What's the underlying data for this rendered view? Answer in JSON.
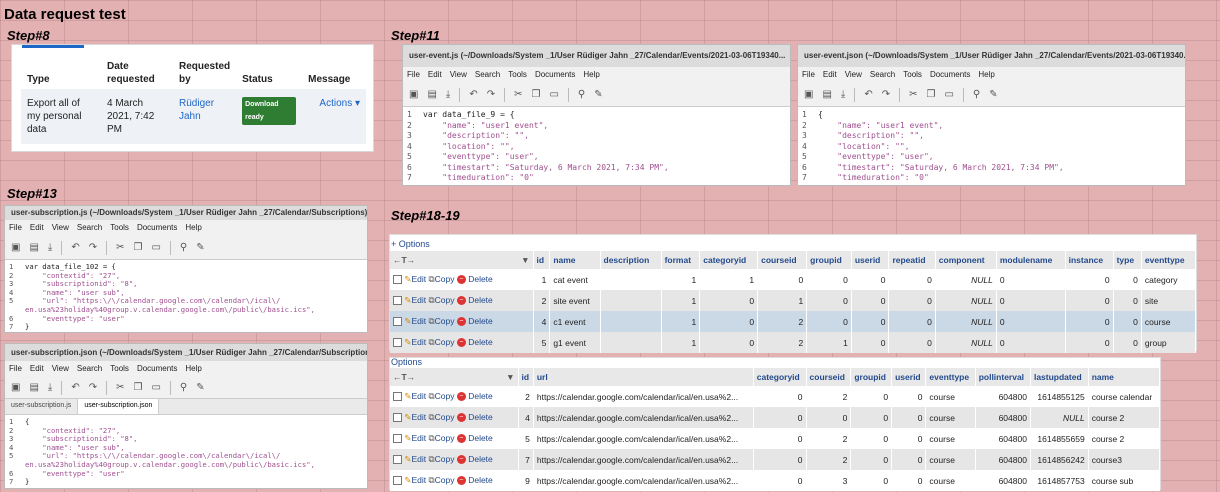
{
  "page_title": "Data request test",
  "steps": {
    "s8": "Step#8",
    "s11": "Step#11",
    "s13": "Step#13",
    "s18": "Step#18-19"
  },
  "request": {
    "headers": [
      "Type",
      "Date requested",
      "Requested by",
      "Status",
      "Message"
    ],
    "row": {
      "type": "Export all of my personal data",
      "date": "4 March 2021, 7:42 PM",
      "by": "Rüdiger Jahn",
      "status": "Download ready",
      "action": "Actions ▾"
    }
  },
  "editor_menu": [
    "File",
    "Edit",
    "View",
    "Search",
    "Tools",
    "Documents",
    "Help"
  ],
  "win_event_js": {
    "title": "user-event.js (~/Downloads/System _1/User Rüdiger Jahn _27/Calendar/Events/2021-03-06T19340...",
    "lines": [
      "var data_file_9 = {",
      "    \"name\": \"user1 event\",",
      "    \"description\": \"\",",
      "    \"location\": \"\",",
      "    \"eventtype\": \"user\",",
      "    \"timestart\": \"Saturday, 6 March 2021, 7:34 PM\",",
      "    \"timeduration\": \"0\"",
      "}"
    ]
  },
  "win_event_json": {
    "title": "user-event.json (~/Downloads/System _1/User Rüdiger Jahn _27/Calendar/Events/2021-03-06T19340...",
    "lines": [
      "{",
      "    \"name\": \"user1 event\",",
      "    \"description\": \"\",",
      "    \"location\": \"\",",
      "    \"eventtype\": \"user\",",
      "    \"timestart\": \"Saturday, 6 March 2021, 7:34 PM\",",
      "    \"timeduration\": \"0\"",
      "}"
    ]
  },
  "win_sub_js": {
    "title": "user-subscription.js (~/Downloads/System _1/User Rüdiger Jahn _27/Calendar/Subscriptions)",
    "lines": [
      "var data_file_102 = {",
      "    \"contextid\": \"27\",",
      "    \"subscriptionid\": \"8\",",
      "    \"name\": \"user sub\",",
      "    \"url\": \"https:\\/\\/calendar.google.com\\/calendar\\/ical\\/",
      "en.usa%23holiday%40group.v.calendar.google.com\\/public\\/basic.ics\",",
      "    \"eventtype\": \"user\"",
      "}"
    ],
    "nums": [
      "1",
      "2",
      "3",
      "4",
      "5",
      "",
      "6",
      "7"
    ]
  },
  "win_sub_json": {
    "title": "user-subscription.json (~/Downloads/System _1/User Rüdiger Jahn _27/Calendar/Subscriptions)",
    "tabs": [
      "user-subscription.js",
      "user-subscription.json"
    ],
    "lines": [
      "{",
      "    \"contextid\": \"27\",",
      "    \"subscriptionid\": \"8\",",
      "    \"name\": \"user sub\",",
      "    \"url\": \"https:\\/\\/calendar.google.com\\/calendar\\/ical\\/",
      "en.usa%23holiday%40group.v.calendar.google.com\\/public\\/basic.ics\",",
      "    \"eventtype\": \"user\"",
      "}"
    ],
    "nums": [
      "1",
      "2",
      "3",
      "4",
      "5",
      "",
      "6",
      "7"
    ]
  },
  "events_table": {
    "options": "+ Options",
    "headers": [
      "id",
      "name",
      "description",
      "format",
      "categoryid",
      "courseid",
      "groupid",
      "userid",
      "repeatid",
      "component",
      "modulename",
      "instance",
      "type",
      "eventtype"
    ],
    "actions": {
      "edit": "Edit",
      "copy": "Copy",
      "delete": "Delete"
    },
    "rows": [
      [
        "1",
        "cat event",
        "",
        "1",
        "1",
        "0",
        "0",
        "0",
        "0",
        "NULL",
        "0",
        "0",
        "0",
        "category"
      ],
      [
        "2",
        "site event",
        "",
        "1",
        "0",
        "1",
        "0",
        "0",
        "0",
        "NULL",
        "0",
        "0",
        "0",
        "site"
      ],
      [
        "4",
        "c1 event",
        "",
        "1",
        "0",
        "2",
        "0",
        "0",
        "0",
        "NULL",
        "0",
        "0",
        "0",
        "course"
      ],
      [
        "5",
        "g1 event",
        "",
        "1",
        "0",
        "2",
        "1",
        "0",
        "0",
        "NULL",
        "0",
        "0",
        "0",
        "group"
      ]
    ]
  },
  "subs_table": {
    "options": "Options",
    "headers": [
      "id",
      "url",
      "categoryid",
      "courseid",
      "groupid",
      "userid",
      "eventtype",
      "pollinterval",
      "lastupdated",
      "name"
    ],
    "rows": [
      [
        "2",
        "https://calendar.google.com/calendar/ical/en.usa%2...",
        "0",
        "2",
        "0",
        "0",
        "course",
        "604800",
        "1614855125",
        "course calendar"
      ],
      [
        "4",
        "https://calendar.google.com/calendar/ical/en.usa%2...",
        "0",
        "0",
        "0",
        "0",
        "course",
        "604800",
        "NULL",
        "course 2"
      ],
      [
        "5",
        "https://calendar.google.com/calendar/ical/en.usa%2...",
        "0",
        "2",
        "0",
        "0",
        "course",
        "604800",
        "1614855659",
        "course 2"
      ],
      [
        "7",
        "https://calendar.google.com/calendar/ical/en.usa%2...",
        "0",
        "2",
        "0",
        "0",
        "course",
        "604800",
        "1614856242",
        "course3"
      ],
      [
        "9",
        "https://calendar.google.com/calendar/ical/en.usa%2...",
        "0",
        "3",
        "0",
        "0",
        "course",
        "604800",
        "1614857753",
        "course sub"
      ]
    ]
  }
}
